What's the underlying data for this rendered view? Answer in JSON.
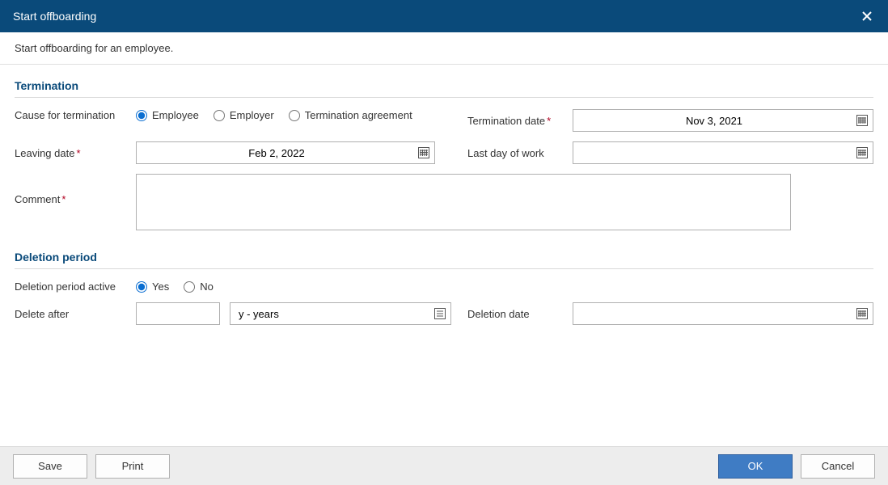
{
  "titlebar": {
    "title": "Start offboarding"
  },
  "subtitle": "Start offboarding for an employee.",
  "sections": {
    "termination": {
      "title": "Termination",
      "cause_label": "Cause for termination",
      "cause_options": {
        "employee": "Employee",
        "employer": "Employer",
        "agreement": "Termination agreement"
      },
      "termination_date_label": "Termination date",
      "termination_date_value": "Nov 3, 2021",
      "leaving_date_label": "Leaving date",
      "leaving_date_value": "Feb 2, 2022",
      "last_day_label": "Last day of work",
      "last_day_value": "",
      "comment_label": "Comment",
      "comment_value": ""
    },
    "deletion": {
      "title": "Deletion period",
      "active_label": "Deletion period active",
      "active_options": {
        "yes": "Yes",
        "no": "No"
      },
      "delete_after_label": "Delete after",
      "delete_after_value": "",
      "delete_after_unit": "y - years",
      "deletion_date_label": "Deletion date",
      "deletion_date_value": ""
    }
  },
  "footer": {
    "save": "Save",
    "print": "Print",
    "ok": "OK",
    "cancel": "Cancel"
  }
}
